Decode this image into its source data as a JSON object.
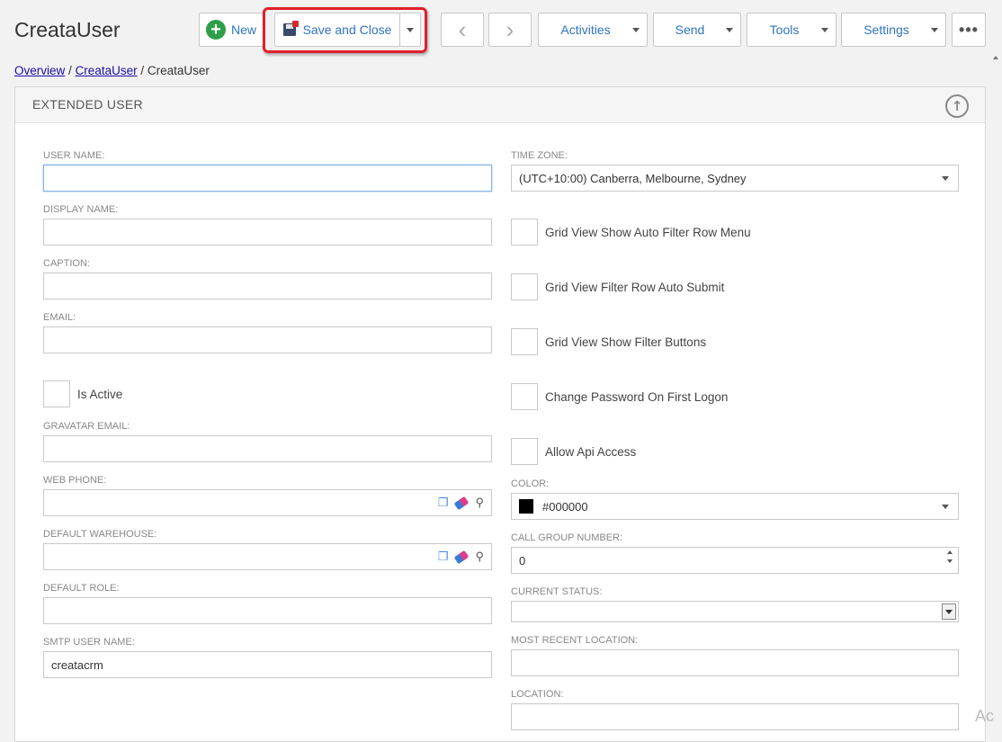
{
  "app": {
    "title": "CreataUser"
  },
  "toolbar": {
    "new_label": "New",
    "save_close_label": "Save and Close",
    "activities_label": "Activities",
    "send_label": "Send",
    "tools_label": "Tools",
    "settings_label": "Settings",
    "more_label": "•••",
    "prev_label": "‹",
    "next_label": "›",
    "plus_label": "+"
  },
  "breadcrumb": {
    "items": [
      "Overview",
      "CreataUser",
      "CreataUser"
    ],
    "separator": "/"
  },
  "panel": {
    "title": "EXTENDED USER",
    "collapse_label": "↑"
  },
  "left_fields": {
    "user_name": {
      "label": "USER NAME:",
      "value": ""
    },
    "display_name": {
      "label": "DISPLAY NAME:",
      "value": ""
    },
    "caption": {
      "label": "CAPTION:",
      "value": ""
    },
    "email": {
      "label": "EMAIL:",
      "value": ""
    },
    "is_active": {
      "label": "Is Active",
      "checked": false
    },
    "gravatar_email": {
      "label": "GRAVATAR EMAIL:",
      "value": ""
    },
    "web_phone": {
      "label": "WEB PHONE:",
      "value": ""
    },
    "default_warehouse": {
      "label": "DEFAULT WAREHOUSE:",
      "value": ""
    },
    "default_role": {
      "label": "DEFAULT ROLE:",
      "value": ""
    },
    "smtp_user_name": {
      "label": "SMTP USER NAME:",
      "value": "creatacrm"
    }
  },
  "right_fields": {
    "time_zone": {
      "label": "TIME ZONE:",
      "value": "(UTC+10:00) Canberra, Melbourne, Sydney"
    },
    "grid_view_show_auto_filter_row_menu": {
      "label": "Grid View Show Auto Filter Row Menu",
      "checked": false
    },
    "grid_view_filter_row_auto_submit": {
      "label": "Grid View Filter Row Auto Submit",
      "checked": false
    },
    "grid_view_show_filter_buttons": {
      "label": "Grid View Show Filter Buttons",
      "checked": false
    },
    "change_password_on_first_logon": {
      "label": "Change Password On First Logon",
      "checked": false
    },
    "allow_api_access": {
      "label": "Allow Api Access",
      "checked": false
    },
    "color": {
      "label": "COLOR:",
      "value": "#000000",
      "swatch": "#000000"
    },
    "call_group_number": {
      "label": "CALL GROUP NUMBER:",
      "value": "0"
    },
    "current_status": {
      "label": "CURRENT STATUS:",
      "value": ""
    },
    "most_recent_location": {
      "label": "MOST RECENT LOCATION:",
      "value": ""
    },
    "location": {
      "label": "LOCATION:",
      "value": ""
    }
  },
  "icons": {
    "copy": "❐",
    "search": "⚲"
  },
  "watermark": "Ac",
  "colors": {
    "accent_blue": "#2f73c0",
    "highlight_red": "#e0202a",
    "new_green": "#2e9e48",
    "link": "#1a0dab"
  }
}
